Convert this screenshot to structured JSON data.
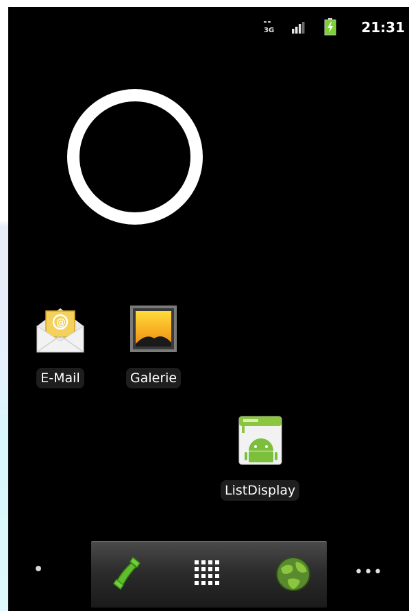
{
  "status_bar": {
    "network": "3G",
    "time": "21:31",
    "icons": [
      "network-3g-icon",
      "signal-icon",
      "battery-charging-icon"
    ]
  },
  "home": {
    "widgets": [
      "analog-clock-widget"
    ],
    "apps": [
      {
        "label": "E-Mail",
        "icon": "email-icon"
      },
      {
        "label": "Galerie",
        "icon": "gallery-icon"
      },
      {
        "label": "ListDisplay",
        "icon": "android-app-icon"
      }
    ]
  },
  "dock": {
    "items": [
      "phone-icon",
      "app-drawer-icon",
      "browser-icon"
    ]
  },
  "colors": {
    "background": "#000000",
    "battery_green": "#7bd232",
    "phone_green": "#5fbf2a",
    "email_yellow": "#f2c33b"
  }
}
